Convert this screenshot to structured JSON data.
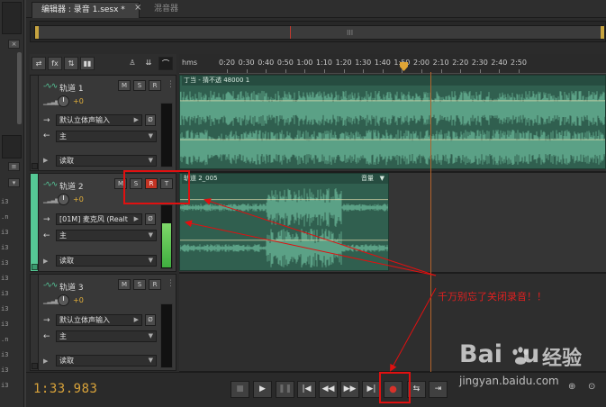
{
  "tabs": [
    {
      "label": "编辑器 : 录音 1.sesx *",
      "active": true
    },
    {
      "label": "混音器",
      "active": false
    }
  ],
  "close_glyph": "×",
  "left_panel": {
    "files": [
      "i3",
      ".n",
      "i3",
      "i3",
      "i3",
      "i3",
      "i3",
      "i3",
      "i3",
      ".n",
      "i3",
      "i3",
      "i3"
    ],
    "controls": [
      "×",
      "≡",
      "▾"
    ]
  },
  "overview": {
    "grip_glyph": "III"
  },
  "toolbar": {
    "buttons": [
      {
        "name": "switch-icon",
        "glyph": "⇄"
      },
      {
        "name": "fx-icon",
        "glyph": "fx"
      },
      {
        "name": "sends-icon",
        "glyph": "⇅"
      },
      {
        "name": "eq-icon",
        "glyph": "▮▮"
      },
      {
        "name": "metronome-icon",
        "glyph": "♙"
      },
      {
        "name": "tracks-icon",
        "glyph": "⇊"
      },
      {
        "name": "headphones-icon",
        "glyph": "⌒"
      }
    ]
  },
  "ruler": {
    "unit": "hms",
    "labels": [
      "0:20",
      "0:30",
      "0:40",
      "0:50",
      "1:00",
      "1:10",
      "1:20",
      "1:30",
      "1:40",
      "1:50",
      "2:00",
      "2:10",
      "2:20",
      "2:30",
      "2:40",
      "2:50"
    ]
  },
  "tracks": [
    {
      "name": "轨道 1",
      "m": "M",
      "s": "S",
      "r": "R",
      "t": "",
      "volume": "+0",
      "input": "默认立体声输入",
      "output": "主",
      "mode": "读取",
      "armed": false,
      "selected": false,
      "meter_level": 0.0
    },
    {
      "name": "轨道 2",
      "m": "M",
      "s": "S",
      "r": "R",
      "t": "T",
      "volume": "+0",
      "input": "[01M] 麦克风 (Realt",
      "output": "主",
      "mode": "读取",
      "armed": true,
      "selected": true,
      "meter_level": 0.72
    },
    {
      "name": "轨道 3",
      "m": "M",
      "s": "S",
      "r": "R",
      "t": "",
      "volume": "+0",
      "input": "默认立体声输入",
      "output": "主",
      "mode": "读取",
      "armed": false,
      "selected": false,
      "meter_level": 0.0
    }
  ],
  "clips": [
    {
      "track": 0,
      "title": "丁当 - 猜不透 48000 1",
      "volume_label": ""
    },
    {
      "track": 1,
      "title": "轨道 2_005",
      "volume_label": "音量"
    }
  ],
  "transport": {
    "time": "1:33.983",
    "buttons": [
      {
        "name": "stop-button",
        "glyph": "■",
        "disabled": true
      },
      {
        "name": "play-button",
        "glyph": "▶",
        "disabled": false
      },
      {
        "name": "pause-button",
        "glyph": "❚❚",
        "disabled": true
      },
      {
        "name": "go-to-start-button",
        "glyph": "|◀",
        "disabled": false
      },
      {
        "name": "rewind-button",
        "glyph": "◀◀",
        "disabled": false
      },
      {
        "name": "fast-forward-button",
        "glyph": "▶▶",
        "disabled": false
      },
      {
        "name": "go-to-end-button",
        "glyph": "▶|",
        "disabled": false
      },
      {
        "name": "record-button",
        "glyph": "●",
        "disabled": false
      },
      {
        "name": "loop-button",
        "glyph": "⇆",
        "disabled": false
      },
      {
        "name": "skip-button",
        "glyph": "⇥",
        "disabled": false
      }
    ]
  },
  "annotation": {
    "text": "千万别忘了关闭录音！！",
    "color": "#e02020"
  },
  "watermark": {
    "logo_text_a": "Bai",
    "logo_text_b": "u",
    "cn": "经验",
    "url": "jingyan.baidu.com"
  },
  "colors": {
    "waveform": "#7fd8b4",
    "clip_bg": "#305f4f",
    "record_red": "#c43424",
    "time_orange": "#d9a33a",
    "playhead": "#b2632c"
  }
}
